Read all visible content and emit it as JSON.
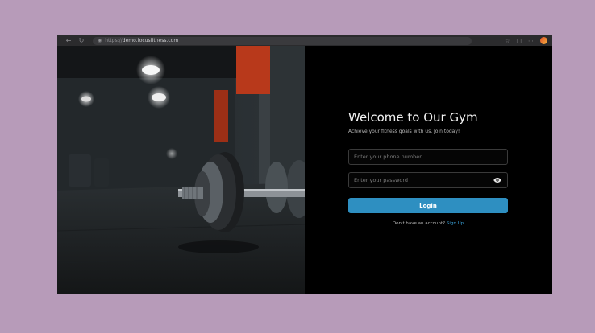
{
  "browser": {
    "url_prefix": "https://",
    "url_host": "demo.focusfitness.com",
    "back_icon": "arrow-left-icon",
    "reload_icon": "reload-icon"
  },
  "hero": {
    "image_subject": "dumbbell-rack-in-dark-gym"
  },
  "login": {
    "title": "Welcome to Our Gym",
    "subtitle": "Achieve your fitness goals with us. Join today!",
    "phone_placeholder": "Enter your phone number",
    "password_placeholder": "Enter your password",
    "login_label": "Login",
    "no_account_text": "Don't have an account?",
    "signup_label": "Sign Up"
  },
  "colors": {
    "page_background": "#b79bb9",
    "panel_background": "#000000",
    "button": "#2e8fc1",
    "link": "#3ba3db"
  }
}
